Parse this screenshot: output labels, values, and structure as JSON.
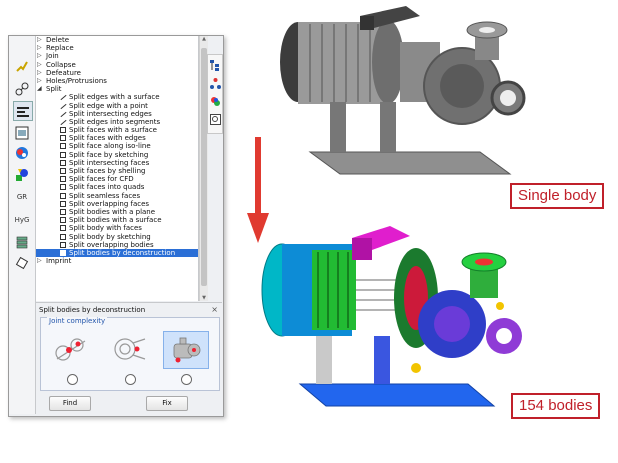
{
  "tree": {
    "items": [
      {
        "kind": "top",
        "label": "Delete"
      },
      {
        "kind": "top",
        "label": "Replace"
      },
      {
        "kind": "top",
        "label": "Join"
      },
      {
        "kind": "top",
        "label": "Collapse"
      },
      {
        "kind": "top",
        "label": "Defeature"
      },
      {
        "kind": "top",
        "label": "Holes/Protrusions"
      },
      {
        "kind": "top-open",
        "label": "Split"
      },
      {
        "kind": "edge",
        "label": "Split edges with a surface"
      },
      {
        "kind": "edge",
        "label": "Split edge with a point"
      },
      {
        "kind": "edge",
        "label": "Split intersecting edges"
      },
      {
        "kind": "edge",
        "label": "Split edges into segments"
      },
      {
        "kind": "face",
        "label": "Split faces with a surface"
      },
      {
        "kind": "face",
        "label": "Split faces with edges"
      },
      {
        "kind": "face",
        "label": "Split face along iso-line"
      },
      {
        "kind": "face",
        "label": "Split face by sketching"
      },
      {
        "kind": "face",
        "label": "Split intersecting faces"
      },
      {
        "kind": "face",
        "label": "Split faces by shelling"
      },
      {
        "kind": "face",
        "label": "Split faces for CFD"
      },
      {
        "kind": "face",
        "label": "Split faces into quads"
      },
      {
        "kind": "face",
        "label": "Split seamless faces"
      },
      {
        "kind": "face",
        "label": "Split overlapping faces"
      },
      {
        "kind": "body",
        "label": "Split bodies with a plane"
      },
      {
        "kind": "body",
        "label": "Split bodies with a surface"
      },
      {
        "kind": "body",
        "label": "Split body with faces"
      },
      {
        "kind": "body",
        "label": "Split body by sketching"
      },
      {
        "kind": "body",
        "label": "Split overlapping bodies"
      },
      {
        "kind": "body-selected",
        "label": "Split bodies by deconstruction"
      },
      {
        "kind": "top",
        "label": "Imprint"
      }
    ]
  },
  "left_toolbar": {
    "items": [
      {
        "icon": "check-wand-icon",
        "text": ""
      },
      {
        "icon": "nodes-icon",
        "text": ""
      },
      {
        "icon": "split-tool-icon",
        "text": ""
      },
      {
        "icon": "panel-icon",
        "text": ""
      },
      {
        "icon": "color-sphere-icon",
        "text": ""
      },
      {
        "icon": "colored-shapes-icon",
        "text": ""
      },
      {
        "icon": "gr-icon",
        "text": "GR"
      },
      {
        "icon": "hyg-icon",
        "text": "HyG"
      },
      {
        "icon": "stack-icon",
        "text": ""
      },
      {
        "icon": "rotate-icon",
        "text": ""
      }
    ]
  },
  "right_toolbar": {
    "items": [
      "tree-view-icon",
      "hierarchy-icon",
      "color-balls-icon",
      "zoom-icon"
    ]
  },
  "subpanel": {
    "title": "Split bodies by deconstruction",
    "close": "×",
    "group_title": "Joint complexity",
    "find_label": "Find",
    "fix_label": "Fix"
  },
  "labels": {
    "single_body": "Single body",
    "bodies_count": "154 bodies"
  },
  "colors": {
    "selection": "#2b6fd6",
    "label_red": "#c0202a",
    "arrow_red": "#e03a30"
  }
}
